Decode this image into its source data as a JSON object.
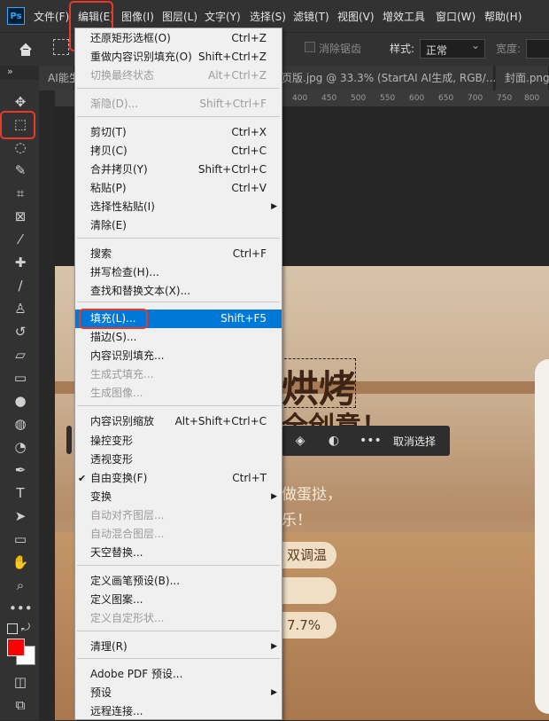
{
  "app": {
    "logo": "Ps"
  },
  "menubar": {
    "items": [
      "文件(F)",
      "编辑(E)",
      "图像(I)",
      "图层(L)",
      "文字(Y)",
      "选择(S)",
      "滤镜(T)",
      "视图(V)",
      "增效工具",
      "窗口(W)",
      "帮助(H)"
    ]
  },
  "options_bar": {
    "antialias_label": "消除锯齿",
    "style_label": "样式:",
    "style_value": "正常",
    "width_label": "宽度:"
  },
  "tabs": {
    "collapse": "»",
    "items": [
      "AI能生",
      "页版.jpg @ 33.3% (StartAI AI生成, RGB/...",
      "封面.png"
    ]
  },
  "ruler": {
    "ticks": [
      "400",
      "450",
      "500",
      "550",
      "600",
      "650",
      "700",
      "750",
      "800",
      "850"
    ]
  },
  "canvas": {
    "headline": "烘烤",
    "headline2": "全创意！",
    "subline1": "做蛋挞，",
    "subline2": "乐！",
    "pill1": "双调温",
    "pill2": "",
    "pill3": "7.7%",
    "context_bar": {
      "cancel_label": "取消选择"
    }
  },
  "edit_menu": {
    "items": [
      {
        "label": "还原矩形选框(O)",
        "shortcut": "Ctrl+Z",
        "disabled": false
      },
      {
        "label": "重做内容识别填充(O)",
        "shortcut": "Shift+Ctrl+Z",
        "disabled": false
      },
      {
        "label": "切换最终状态",
        "shortcut": "Alt+Ctrl+Z",
        "disabled": true
      },
      {
        "label": "渐隐(D)...",
        "shortcut": "Shift+Ctrl+F",
        "disabled": true
      },
      {
        "label": "剪切(T)",
        "shortcut": "Ctrl+X",
        "disabled": false
      },
      {
        "label": "拷贝(C)",
        "shortcut": "Ctrl+C",
        "disabled": false
      },
      {
        "label": "合并拷贝(Y)",
        "shortcut": "Shift+Ctrl+C",
        "disabled": false
      },
      {
        "label": "粘贴(P)",
        "shortcut": "Ctrl+V",
        "disabled": false
      },
      {
        "label": "选择性粘贴(I)",
        "shortcut": "",
        "disabled": false,
        "submenu": true
      },
      {
        "label": "清除(E)",
        "shortcut": "",
        "disabled": false
      },
      {
        "label": "搜索",
        "shortcut": "Ctrl+F",
        "disabled": false
      },
      {
        "label": "拼写检查(H)...",
        "shortcut": "",
        "disabled": false
      },
      {
        "label": "查找和替换文本(X)...",
        "shortcut": "",
        "disabled": false
      },
      {
        "label": "填充(L)...",
        "shortcut": "Shift+F5",
        "disabled": false,
        "highlighted": true
      },
      {
        "label": "描边(S)...",
        "shortcut": "",
        "disabled": false
      },
      {
        "label": "内容识别填充...",
        "shortcut": "",
        "disabled": false
      },
      {
        "label": "生成式填充...",
        "shortcut": "",
        "disabled": true
      },
      {
        "label": "生成图像...",
        "shortcut": "",
        "disabled": true
      },
      {
        "label": "内容识别缩放",
        "shortcut": "Alt+Shift+Ctrl+C",
        "disabled": false
      },
      {
        "label": "操控变形",
        "shortcut": "",
        "disabled": false
      },
      {
        "label": "透视变形",
        "shortcut": "",
        "disabled": false
      },
      {
        "label": "自由变换(F)",
        "shortcut": "Ctrl+T",
        "disabled": false,
        "checked": true
      },
      {
        "label": "变换",
        "shortcut": "",
        "disabled": false,
        "submenu": true
      },
      {
        "label": "自动对齐图层...",
        "shortcut": "",
        "disabled": true
      },
      {
        "label": "自动混合图层...",
        "shortcut": "",
        "disabled": true
      },
      {
        "label": "天空替换...",
        "shortcut": "",
        "disabled": false
      },
      {
        "label": "定义画笔预设(B)...",
        "shortcut": "",
        "disabled": false
      },
      {
        "label": "定义图案...",
        "shortcut": "",
        "disabled": false
      },
      {
        "label": "定义自定形状...",
        "shortcut": "",
        "disabled": true
      },
      {
        "label": "清理(R)",
        "shortcut": "",
        "disabled": false,
        "submenu": true
      },
      {
        "label": "Adobe PDF 预设...",
        "shortcut": "",
        "disabled": false
      },
      {
        "label": "预设",
        "shortcut": "",
        "disabled": false,
        "submenu": true
      },
      {
        "label": "远程连接...",
        "shortcut": "",
        "disabled": false
      }
    ]
  },
  "colors": {
    "highlight": "#0078d7",
    "annotation_red": "#e8392a",
    "foreground_swatch": "#ff0000",
    "background_swatch": "#ffffff"
  }
}
